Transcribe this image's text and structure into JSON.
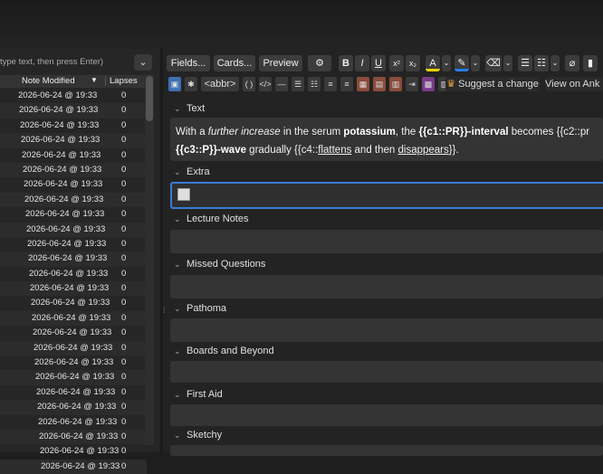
{
  "browser": {
    "search_placeholder": "type text, then press Enter)",
    "columns": {
      "modified": "Note Modified",
      "lapses": "Lapses"
    },
    "rows": [
      {
        "date": "2026-06-24 @ 19:33",
        "lapses": "0"
      },
      {
        "date": "2026-06-24 @ 19:33",
        "lapses": "0"
      },
      {
        "date": "2026-06-24 @ 19:33",
        "lapses": "0"
      },
      {
        "date": "2026-06-24 @ 19:33",
        "lapses": "0"
      },
      {
        "date": "2026-06-24 @ 19:33",
        "lapses": "0"
      },
      {
        "date": "2026-06-24 @ 19:33",
        "lapses": "0"
      },
      {
        "date": "2026-06-24 @ 19:33",
        "lapses": "0"
      },
      {
        "date": "2026-06-24 @ 19:33",
        "lapses": "0"
      },
      {
        "date": "2026-06-24 @ 19:33",
        "lapses": "0"
      },
      {
        "date": "2026-06-24 @ 19:33",
        "lapses": "0"
      },
      {
        "date": "2026-06-24 @ 19:33",
        "lapses": "0"
      },
      {
        "date": "2026-06-24 @ 19:33",
        "lapses": "0"
      },
      {
        "date": "2026-06-24 @ 19:33",
        "lapses": "0"
      },
      {
        "date": "2026-06-24 @ 19:33",
        "lapses": "0"
      },
      {
        "date": "2026-06-24 @ 19:33",
        "lapses": "0"
      },
      {
        "date": "2026-06-24 @ 19:33",
        "lapses": "0"
      },
      {
        "date": "2026-06-24 @ 19:33",
        "lapses": "0"
      },
      {
        "date": "2026-06-24 @ 19:33",
        "lapses": "0"
      },
      {
        "date": "2026-06-24 @ 19:33",
        "lapses": "0"
      },
      {
        "date": "2026-06-24 @ 19:33",
        "lapses": "0"
      },
      {
        "date": "2026-06-24 @ 19:33",
        "lapses": "0"
      },
      {
        "date": "2026-06-24 @ 19:33",
        "lapses": "0"
      },
      {
        "date": "2026-06-24 @ 19:33",
        "lapses": "0"
      },
      {
        "date": "2026-06-24 @ 19:33",
        "lapses": "0"
      },
      {
        "date": "2026-06-24 @ 19:33",
        "lapses": "0"
      },
      {
        "date": "2026-06-24 @ 19:33",
        "lapses": "0"
      }
    ]
  },
  "toolbar": {
    "fields": "Fields...",
    "cards": "Cards...",
    "preview": "Preview",
    "bold": "B",
    "italic": "I",
    "underline": "U",
    "sup": "x²",
    "sub": "x₂",
    "abbr": "<abbr>",
    "parens": "( )",
    "code": "</>",
    "dash": "—",
    "suggest": "Suggest a change",
    "view": "View on Ank"
  },
  "fields": {
    "text": {
      "label": "Text",
      "p1": "With a ",
      "p2": "further increase",
      "p3": " in the serum ",
      "p4": "potassium",
      "p5": ", the ",
      "p6": "{{c1::PR}}-interval",
      "p7": " becomes {{c2::pr",
      "q1": "{{c3::P}}-wave",
      "q2": " gradually {{c4::",
      "q3": "flattens",
      "q4": " and then ",
      "q5": "disappears",
      "q6": "}}."
    },
    "extra": "Extra",
    "lecture": "Lecture Notes",
    "missed": "Missed Questions",
    "pathoma": "Pathoma",
    "boards": "Boards and Beyond",
    "firstaid": "First Aid",
    "sketchy": "Sketchy"
  }
}
